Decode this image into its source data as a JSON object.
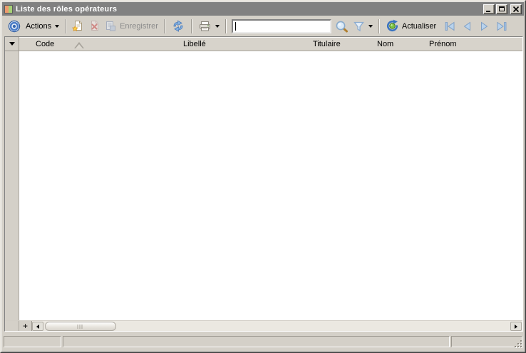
{
  "window": {
    "title": "Liste des rôles opérateurs"
  },
  "toolbar": {
    "actions_label": "Actions",
    "save_label": "Enregistrer",
    "refresh_label": "Actualiser",
    "search": {
      "value": "",
      "placeholder": ""
    },
    "icons": {
      "actions": "target-icon",
      "new": "new-record-icon",
      "delete": "delete-record-icon",
      "save": "save-document-icon",
      "sync": "sync-arrows-icon",
      "print": "printer-icon",
      "search": "magnifier-icon",
      "filter": "filter-funnel-icon",
      "refresh": "refresh-globe-icon",
      "nav": [
        "first-record-icon",
        "previous-record-icon",
        "next-record-icon",
        "last-record-icon"
      ]
    }
  },
  "grid": {
    "columns": [
      "Code",
      "Libellé",
      "Titulaire",
      "Nom",
      "Prénom"
    ],
    "sort": {
      "column": "Code",
      "direction": "ascending"
    },
    "rows": [],
    "add_row_button": "+"
  },
  "statusbar": {
    "panels": [
      "",
      "",
      ""
    ]
  },
  "colors": {
    "chrome": "#d4d0c8",
    "titlebar": "#818181",
    "title_text": "#ffffff",
    "grid_body": "#ffffff",
    "accent_blue": "#4a7cc8",
    "nav_arrow_fill": "#b8d2ec",
    "disabled_text": "#8b8b8b"
  }
}
